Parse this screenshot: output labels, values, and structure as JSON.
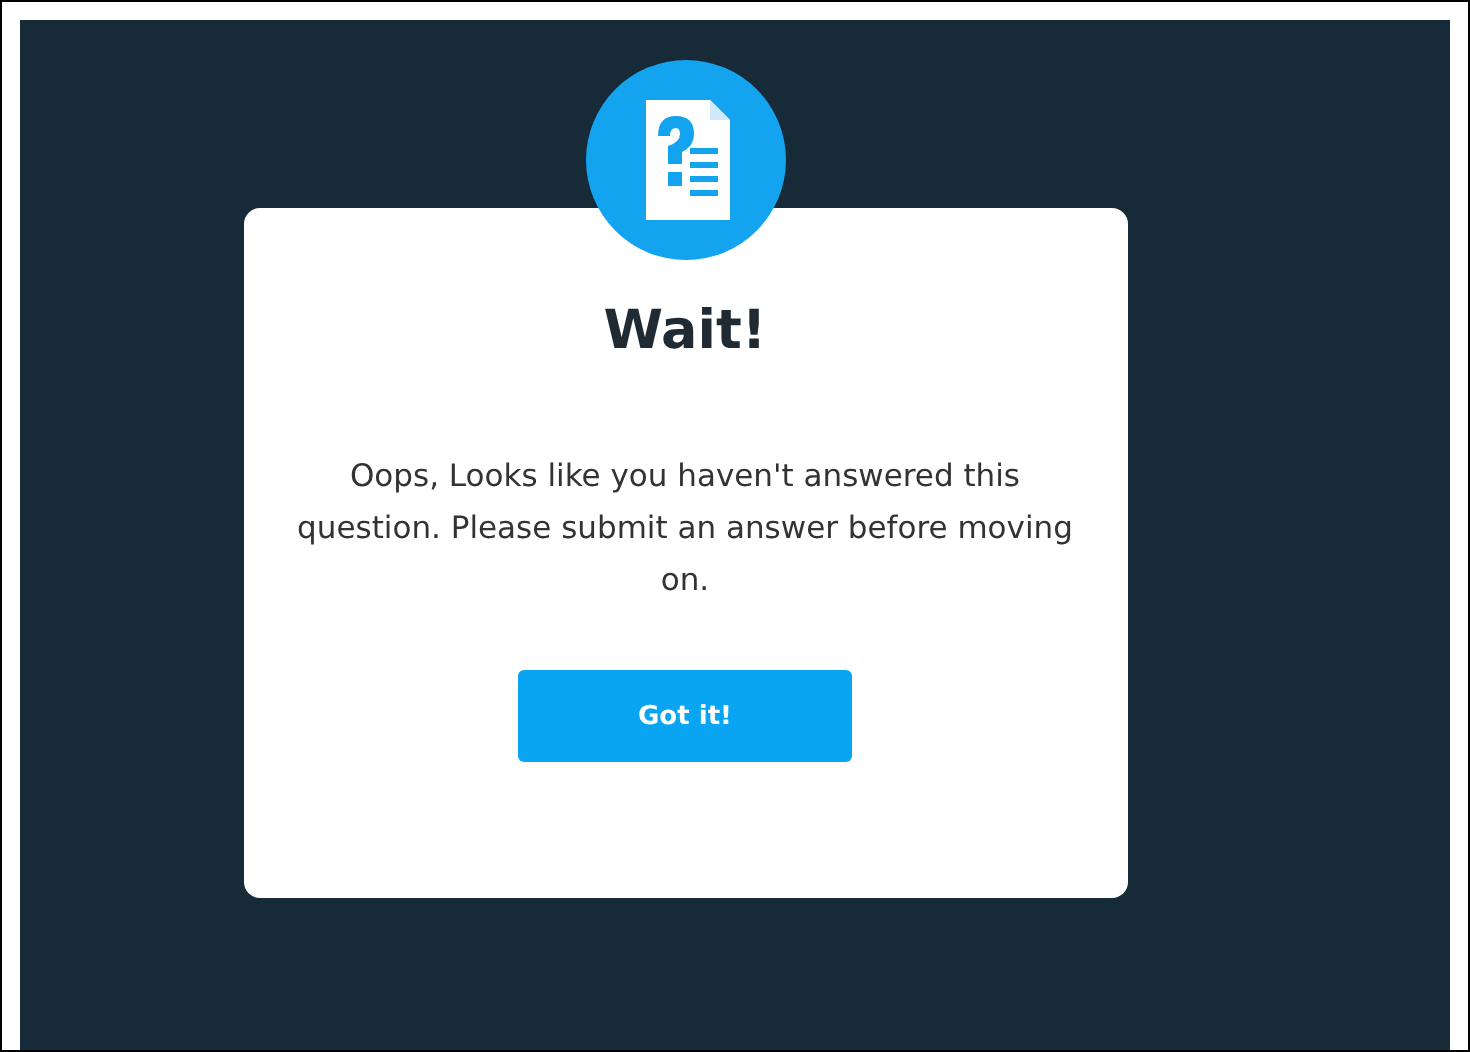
{
  "dialog": {
    "title": "Wait!",
    "message": "Oops, Looks like you haven't answered this question. Please submit an answer before moving on.",
    "button": "Got it!"
  }
}
